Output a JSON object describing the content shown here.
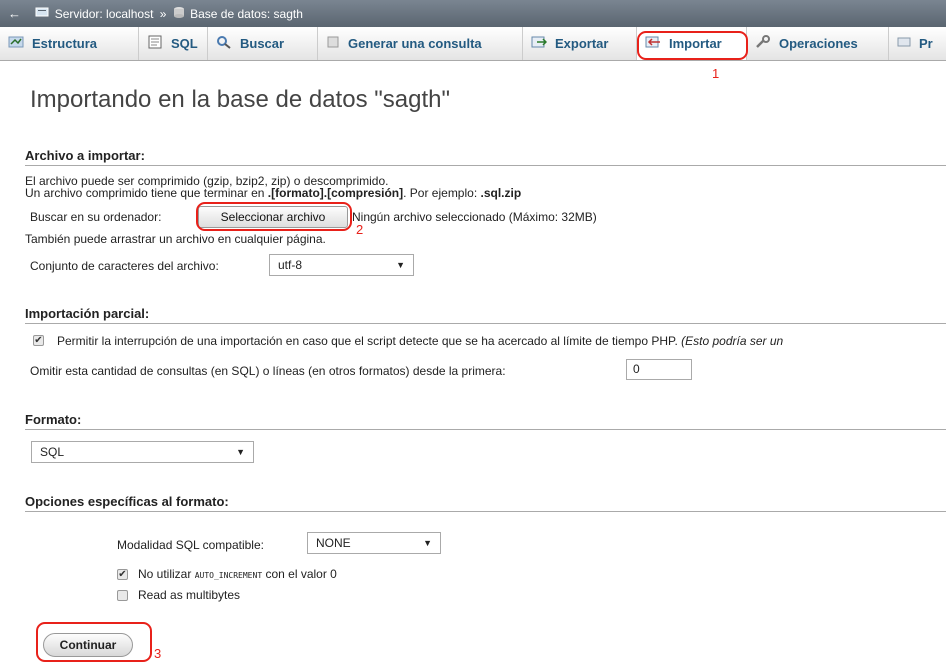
{
  "breadcrumb": {
    "back_icon": "back-arrow-icon",
    "server": "Servidor: localhost",
    "separator": "»",
    "database": "Base de datos: sagth"
  },
  "tabs": [
    {
      "label": "Estructura",
      "icon": "structure-icon"
    },
    {
      "label": "SQL",
      "icon": "sql-icon"
    },
    {
      "label": "Buscar",
      "icon": "search-icon"
    },
    {
      "label": "Generar una consulta",
      "icon": "query-icon"
    },
    {
      "label": "Exportar",
      "icon": "export-icon"
    },
    {
      "label": "Importar",
      "icon": "import-icon",
      "active": true
    },
    {
      "label": "Operaciones",
      "icon": "wrench-icon"
    },
    {
      "label": "Pr",
      "icon": "privileges-icon"
    }
  ],
  "callouts": {
    "one": "1",
    "two": "2",
    "three": "3",
    "color": "#e8211a"
  },
  "page_title": "Importando en la base de datos \"sagth\"",
  "file_section": {
    "title": "Archivo a importar:",
    "line1": "El archivo puede ser comprimido (gzip, bzip2, zip) o descomprimido.",
    "line2_prefix": "Un archivo comprimido tiene que terminar en ",
    "line2_bold": ".[formato].[compresión]",
    "line2_mid": ". Por ejemplo: ",
    "line2_example": ".sql.zip",
    "browse_label": "Buscar en su ordenador:",
    "file_button": "Seleccionar archivo",
    "no_file": "Ningún archivo seleccionado (Máximo: 32MB)",
    "drag_hint": "También puede arrastrar un archivo en cualquier página.",
    "charset_label": "Conjunto de caracteres del archivo:",
    "charset_value": "utf-8"
  },
  "partial_section": {
    "title": "Importación parcial:",
    "interrupt_checked": true,
    "interrupt_label": "Permitir la interrupción de una importación en caso que el script detecte que se ha acercado al límite de tiempo PHP.",
    "interrupt_note": "(Esto podría ser un",
    "skip_label": "Omitir esta cantidad de consultas (en SQL) o líneas (en otros formatos) desde la primera:",
    "skip_value": "0"
  },
  "format_section": {
    "title": "Formato:",
    "format_value": "SQL"
  },
  "options_section": {
    "title": "Opciones específicas al formato:",
    "compat_label": "Modalidad SQL compatible:",
    "compat_value": "NONE",
    "no_autoinc_checked": true,
    "no_autoinc_prefix": "No utilizar",
    "no_autoinc_code": "AUTO_INCREMENT",
    "no_autoinc_suffix": "con el valor 0",
    "multibyte_checked": false,
    "multibyte_label": "Read as multibytes"
  },
  "continue_button": "Continuar"
}
